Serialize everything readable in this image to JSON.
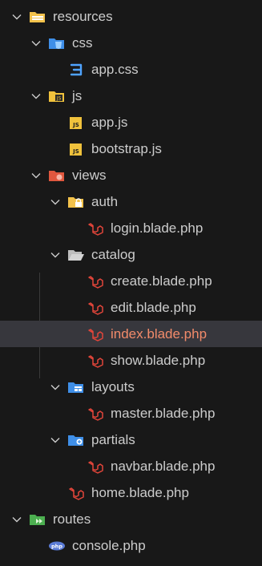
{
  "explorer": {
    "items": [
      {
        "label": "resources",
        "type": "folder",
        "icon": "resources-folder-icon",
        "depth": 0
      },
      {
        "label": "css",
        "type": "folder",
        "icon": "css-folder-icon",
        "depth": 1
      },
      {
        "label": "app.css",
        "type": "file",
        "icon": "css-file-icon",
        "depth": 2
      },
      {
        "label": "js",
        "type": "folder",
        "icon": "js-folder-icon",
        "depth": 1
      },
      {
        "label": "app.js",
        "type": "file",
        "icon": "js-file-icon",
        "depth": 2
      },
      {
        "label": "bootstrap.js",
        "type": "file",
        "icon": "js-file-icon",
        "depth": 2
      },
      {
        "label": "views",
        "type": "folder",
        "icon": "views-folder-icon",
        "depth": 1
      },
      {
        "label": "auth",
        "type": "folder",
        "icon": "auth-folder-icon",
        "depth": 2
      },
      {
        "label": "login.blade.php",
        "type": "file",
        "icon": "blade-file-icon",
        "depth": 3
      },
      {
        "label": "catalog",
        "type": "folder",
        "icon": "open-folder-icon",
        "depth": 2
      },
      {
        "label": "create.blade.php",
        "type": "file",
        "icon": "blade-file-icon",
        "depth": 3
      },
      {
        "label": "edit.blade.php",
        "type": "file",
        "icon": "blade-file-icon",
        "depth": 3
      },
      {
        "label": "index.blade.php",
        "type": "file",
        "icon": "blade-file-icon",
        "depth": 3,
        "selected": true
      },
      {
        "label": "show.blade.php",
        "type": "file",
        "icon": "blade-file-icon",
        "depth": 3
      },
      {
        "label": "layouts",
        "type": "folder",
        "icon": "layouts-folder-icon",
        "depth": 2
      },
      {
        "label": "master.blade.php",
        "type": "file",
        "icon": "blade-file-icon",
        "depth": 3
      },
      {
        "label": "partials",
        "type": "folder",
        "icon": "partials-folder-icon",
        "depth": 2
      },
      {
        "label": "navbar.blade.php",
        "type": "file",
        "icon": "blade-file-icon",
        "depth": 3
      },
      {
        "label": "home.blade.php",
        "type": "file",
        "icon": "blade-file-icon",
        "depth": 2
      },
      {
        "label": "routes",
        "type": "folder",
        "icon": "routes-folder-icon",
        "depth": 0
      },
      {
        "label": "console.php",
        "type": "file",
        "icon": "php-file-icon",
        "depth": 1
      }
    ]
  },
  "colors": {
    "background": "#181818",
    "selected_row": "#37373d",
    "selected_text": "#f28b6a",
    "text": "#cccccc",
    "folder_yellow": "#f3c24b",
    "css_blue": "#4fa3ff",
    "js_yellow": "#f0c23c",
    "views_red": "#e0573e",
    "blade_red": "#e2453a",
    "routes_green": "#4caf50",
    "php_blue": "#5a7bd6"
  }
}
